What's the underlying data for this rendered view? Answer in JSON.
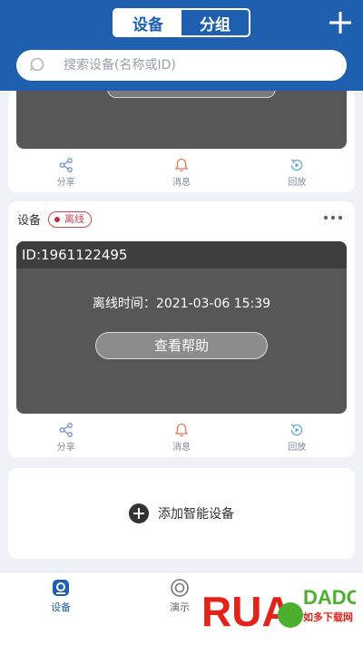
{
  "header": {
    "tabs": [
      {
        "label": "设备",
        "active": true
      },
      {
        "label": "分组",
        "active": false
      }
    ],
    "add_icon": "plus-icon"
  },
  "search": {
    "placeholder": "搜索设备(名称或ID)",
    "value": ""
  },
  "device_cards": [
    {
      "actions": [
        {
          "label": "分享",
          "icon": "share-icon"
        },
        {
          "label": "消息",
          "icon": "bell-icon"
        },
        {
          "label": "回放",
          "icon": "playback-icon"
        }
      ]
    },
    {
      "name": "设备",
      "status": "离线",
      "id_text": "ID:1961122495",
      "offline_text": "离线时间：2021-03-06 15:39",
      "help_button": "查看帮助",
      "actions": [
        {
          "label": "分享",
          "icon": "share-icon"
        },
        {
          "label": "消息",
          "icon": "bell-icon"
        },
        {
          "label": "回放",
          "icon": "playback-icon"
        }
      ]
    }
  ],
  "add_device": {
    "label": "添加智能设备"
  },
  "tabbar": {
    "tabs": [
      {
        "label": "设备",
        "icon": "device-icon",
        "active": true
      },
      {
        "label": "演示",
        "icon": "demo-icon",
        "active": false
      }
    ]
  },
  "watermark": {
    "text": "RUANDADO",
    "subtext": "如多下载网"
  },
  "colors": {
    "primary": "#1f5fb0",
    "offline": "#d4454a",
    "watermark_red": "#e2231a",
    "watermark_green": "#4caf2e"
  }
}
